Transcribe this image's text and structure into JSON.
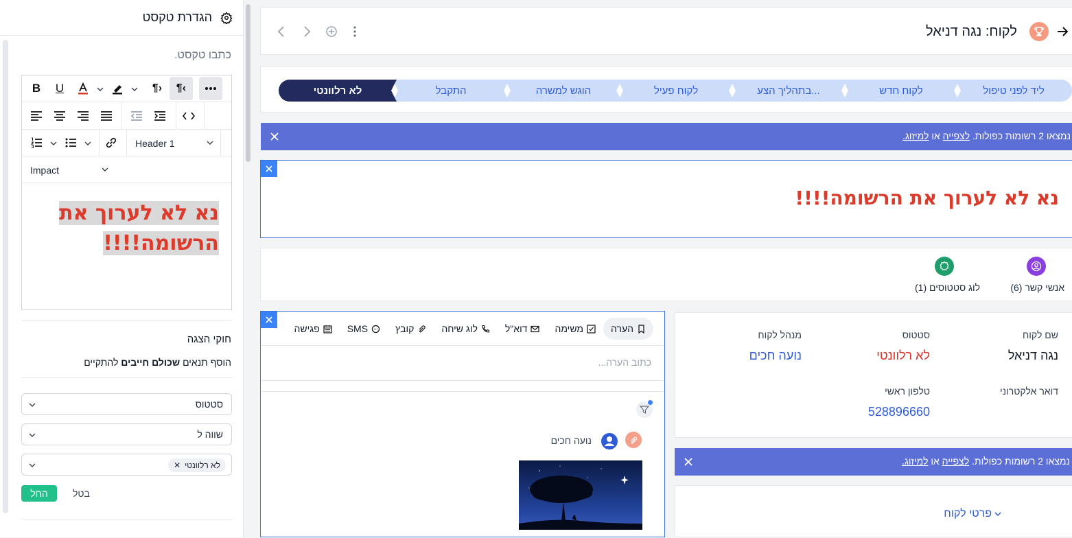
{
  "left_panel": {
    "title": "הגדרת טקסט",
    "hint": "כתבו טקסט.",
    "toolbar": {
      "header_select": "Header 1",
      "font_select": "Impact"
    },
    "editor_text": "נא לא לערוך את הרשומה!!!!",
    "rules": {
      "title": "חוקי הצגה",
      "desc_prefix": "הוסף תנאים",
      "desc_bold": "שכולם חייבים",
      "desc_suffix": "להתקיים"
    },
    "conditions": [
      {
        "value": "סטטוס"
      },
      {
        "value": "שווה ל"
      },
      {
        "chip": "לא רלוונטי"
      }
    ],
    "apply_label": "החל",
    "cancel_label": "בטל"
  },
  "topbar": {
    "title": "לקוח: נגה דניאל"
  },
  "stages": [
    {
      "label": "ליד לפני טיפול",
      "active": false
    },
    {
      "label": "לקוח חדש",
      "active": false
    },
    {
      "label": "בתהליך הצע...",
      "active": false
    },
    {
      "label": "לקוח פעיל",
      "active": false
    },
    {
      "label": "הוגש למשרה",
      "active": false
    },
    {
      "label": "התקבל",
      "active": false
    },
    {
      "label": "לא רלוונטי",
      "active": true
    }
  ],
  "alert": {
    "prefix": "נמצאו 2 רשומות כפולות.",
    "view_link": "לצפייה",
    "or": "או",
    "merge_link": "למיזוג."
  },
  "text_widget": {
    "text": "נא לא לערוך את הרשומה!!!!"
  },
  "related": [
    {
      "label": "אנשי קשר (6)",
      "color": "#8b3fe0",
      "icon": "contact-icon"
    },
    {
      "label": "לוג סטטוסים (1)",
      "color": "#1f9e6b",
      "icon": "status-log-icon"
    }
  ],
  "activity": {
    "tabs": [
      {
        "label": "הערה",
        "icon": "bookmark-icon",
        "active": true
      },
      {
        "label": "משימה",
        "icon": "checkbox-icon",
        "active": false
      },
      {
        "label": "דוא\"ל",
        "icon": "mail-icon",
        "active": false
      },
      {
        "label": "לוג שיחה",
        "icon": "phone-icon",
        "active": false
      },
      {
        "label": "קובץ",
        "icon": "paperclip-icon",
        "active": false
      },
      {
        "label": "SMS",
        "icon": "chat-icon",
        "active": false
      },
      {
        "label": "פגישה",
        "icon": "calendar-icon",
        "active": false
      }
    ],
    "note_placeholder": "כתוב הערה...",
    "feed_author": "נועה חכים"
  },
  "details": {
    "fields": [
      {
        "label": "שם לקוח",
        "value": "נגה דניאל",
        "color": "#111827"
      },
      {
        "label": "סטטוס",
        "value": "לא רלוונטי",
        "color": "#d93025"
      },
      {
        "label": "מנהל לקוח",
        "value": "נועה חכים",
        "color": "#2e5bd6"
      },
      {
        "label": "דואר אלקטרוני",
        "value": "",
        "color": "#111827"
      },
      {
        "label": "טלפון ראשי",
        "value": "528896660",
        "color": "#2e5bd6"
      }
    ]
  },
  "section": {
    "label": "פרטי לקוח"
  }
}
